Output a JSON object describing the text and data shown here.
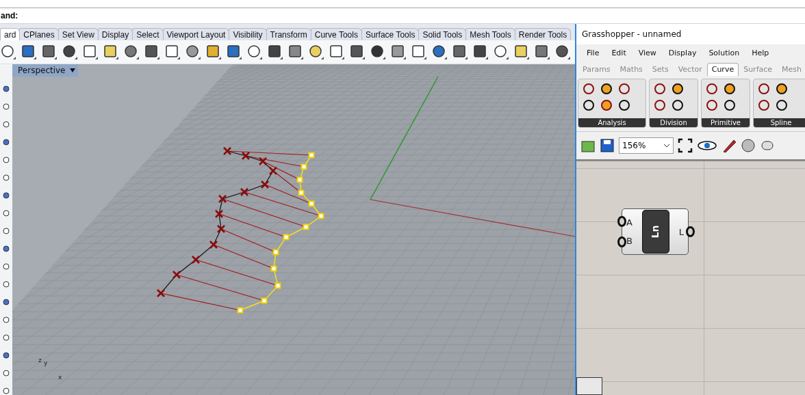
{
  "command_line": {
    "prompt": "and:"
  },
  "rhino_tabs": [
    {
      "label": "ard",
      "selected": true
    },
    {
      "label": "CPlanes",
      "selected": false
    },
    {
      "label": "Set View",
      "selected": false
    },
    {
      "label": "Display",
      "selected": false
    },
    {
      "label": "Select",
      "selected": false
    },
    {
      "label": "Viewport Layout",
      "selected": false
    },
    {
      "label": "Visibility",
      "selected": false
    },
    {
      "label": "Transform",
      "selected": false
    },
    {
      "label": "Curve Tools",
      "selected": false
    },
    {
      "label": "Surface Tools",
      "selected": false
    },
    {
      "label": "Solid Tools",
      "selected": false
    },
    {
      "label": "Mesh Tools",
      "selected": false
    },
    {
      "label": "Render Tools",
      "selected": false
    }
  ],
  "viewport": {
    "title": "Perspective",
    "axis_labels": {
      "z": "z",
      "y": "y",
      "x": "x"
    }
  },
  "grasshopper": {
    "title": "Grasshopper - unnamed",
    "menu": [
      "File",
      "Edit",
      "View",
      "Display",
      "Solution",
      "Help"
    ],
    "tabs": [
      {
        "label": "Params",
        "selected": false
      },
      {
        "label": "Maths",
        "selected": false
      },
      {
        "label": "Sets",
        "selected": false
      },
      {
        "label": "Vector",
        "selected": false
      },
      {
        "label": "Curve",
        "selected": true
      },
      {
        "label": "Surface",
        "selected": false
      },
      {
        "label": "Mesh",
        "selected": false
      }
    ],
    "groups": [
      "Analysis",
      "Division",
      "Primitive",
      "Spline"
    ],
    "zoom": "156%",
    "component": {
      "inputs": [
        "A",
        "B"
      ],
      "nickname": "Ln",
      "outputs": [
        "L"
      ]
    }
  }
}
